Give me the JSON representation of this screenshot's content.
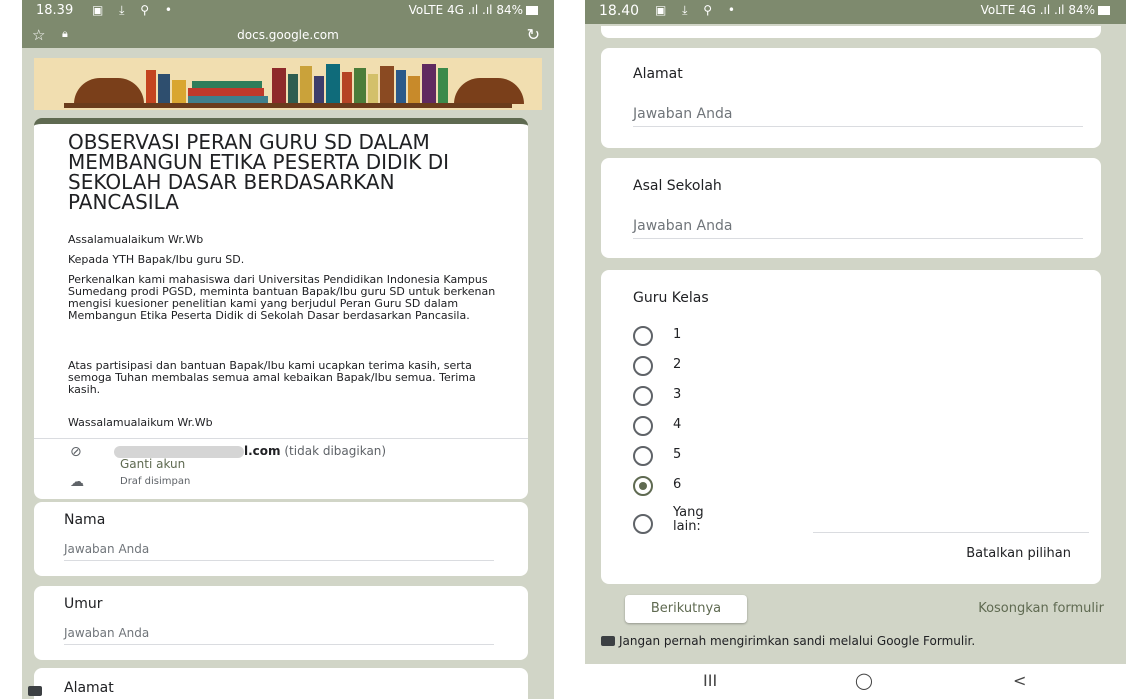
{
  "left": {
    "status": {
      "time": "18.39",
      "icons": "▣ ⤓ ⚲ •",
      "signal": "VoLTE 4G .ıl .ıl 84%"
    },
    "url": "docs.google.com",
    "form": {
      "title": "OBSERVASI PERAN GURU SD DALAM MEMBANGUN ETIKA PESERTA DIDIK DI SEKOLAH DASAR BERDASARKAN PANCASILA",
      "greeting": "Assalamualaikum Wr.Wb",
      "to": "Kepada YTH Bapak/Ibu guru SD.",
      "intro": "Perkenalkan kami mahasiswa dari Universitas Pendidikan Indonesia Kampus Sumedang prodi PGSD, meminta bantuan Bapak/Ibu guru SD untuk berkenan mengisi kuesioner penelitian kami yang berjudul Peran Guru SD dalam Membangun Etika Peserta Didik di Sekolah Dasar berdasarkan Pancasila.",
      "thanks": "Atas partisipasi dan bantuan Bapak/Ibu kami ucapkan terima kasih, serta semoga Tuhan membalas semua amal kebaikan Bapak/Ibu semua. Terima kasih.",
      "closing": "Wassalamualaikum Wr.Wb",
      "email_suffix": "l.com",
      "email_note": "(tidak dibagikan)",
      "switch_account": "Ganti akun",
      "draft": "Draf disimpan"
    },
    "questions": [
      {
        "label": "Nama",
        "placeholder": "Jawaban Anda"
      },
      {
        "label": "Umur",
        "placeholder": "Jawaban Anda"
      },
      {
        "label": "Alamat"
      }
    ]
  },
  "right": {
    "status": {
      "time": "18.40",
      "icons": "▣ ⤓ ⚲ •",
      "signal": "VoLTE 4G .ıl .ıl 84%"
    },
    "questions": [
      {
        "label": "Alamat",
        "placeholder": "Jawaban Anda"
      },
      {
        "label": "Asal Sekolah",
        "placeholder": "Jawaban Anda"
      }
    ],
    "radio_question": {
      "label": "Guru Kelas",
      "options": [
        "1",
        "2",
        "3",
        "4",
        "5",
        "6"
      ],
      "selected": "6",
      "other_label": "Yang lain:",
      "clear_selection": "Batalkan pilihan"
    },
    "next_button": "Berikutnya",
    "clear_form": "Kosongkan formulir",
    "warning": "Jangan pernah mengirimkan sandi melalui Google Formulir.",
    "nav": {
      "recents": "III",
      "home": "◯",
      "back": "<"
    }
  },
  "colors": {
    "theme": "#5f6a51",
    "background": "#d1d5c7",
    "toolbar": "#7e8a6e"
  }
}
